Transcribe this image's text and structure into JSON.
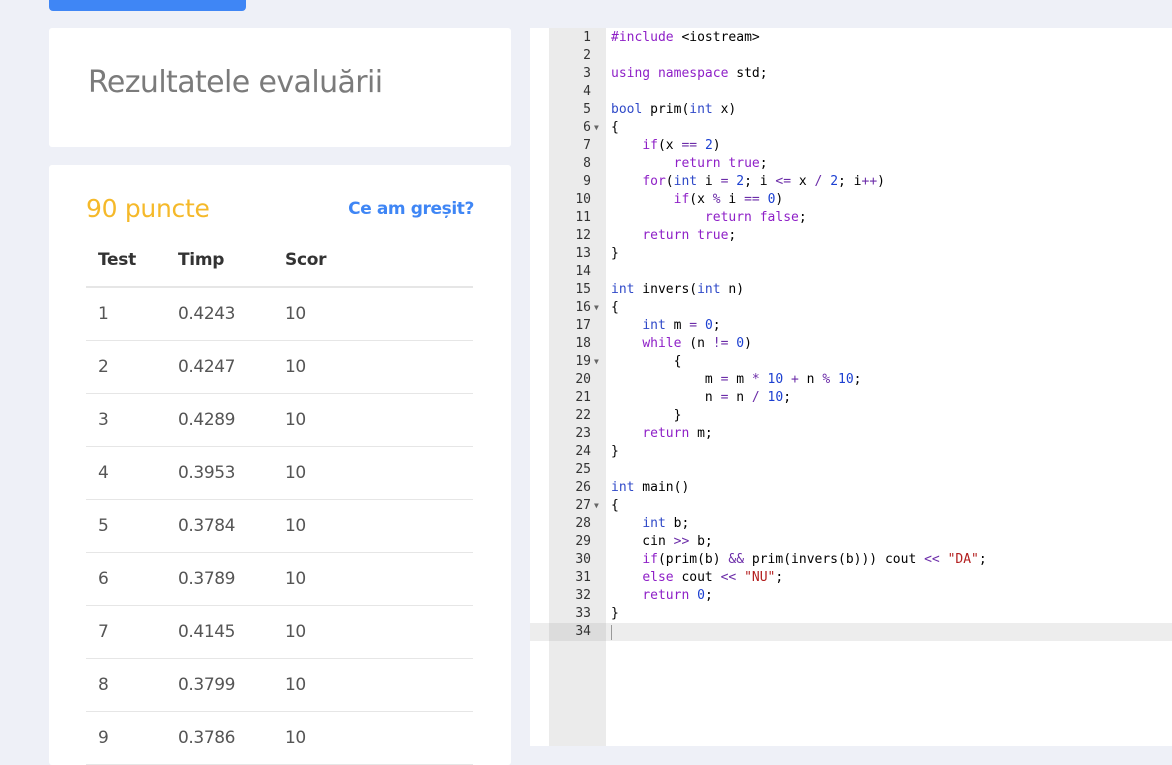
{
  "title": "Rezultatele evaluării",
  "score": {
    "points_label": "90 puncte",
    "link_label": "Ce am greșit?"
  },
  "table": {
    "headers": [
      "Test",
      "Timp",
      "Scor"
    ],
    "rows": [
      [
        "1",
        "0.4243",
        "10"
      ],
      [
        "2",
        "0.4247",
        "10"
      ],
      [
        "3",
        "0.4289",
        "10"
      ],
      [
        "4",
        "0.3953",
        "10"
      ],
      [
        "5",
        "0.3784",
        "10"
      ],
      [
        "6",
        "0.3789",
        "10"
      ],
      [
        "7",
        "0.4145",
        "10"
      ],
      [
        "8",
        "0.3799",
        "10"
      ],
      [
        "9",
        "0.3786",
        "10"
      ]
    ]
  },
  "editor": {
    "active_line": 34,
    "lines": [
      "#include <iostream>",
      "",
      "using namespace std;",
      "",
      "bool prim(int x)",
      "{",
      "    if(x == 2)",
      "        return true;",
      "    for(int i = 2; i <= x / 2; i++)",
      "        if(x % i == 0)",
      "            return false;",
      "    return true;",
      "}",
      "",
      "int invers(int n)",
      "{",
      "    int m = 0;",
      "    while (n != 0)",
      "        {",
      "            m = m * 10 + n % 10;",
      "            n = n / 10;",
      "        }",
      "    return m;",
      "}",
      "",
      "int main()",
      "{",
      "    int b;",
      "    cin >> b;",
      "    if(prim(b) && prim(invers(b))) cout << \"DA\";",
      "    else cout << \"NU\";",
      "    return 0;",
      "}",
      ""
    ],
    "fold_lines": [
      6,
      16,
      19,
      27
    ]
  },
  "colors": {
    "accent": "#3f86f5",
    "points": "#f5b92a",
    "background": "#eef0f7"
  }
}
